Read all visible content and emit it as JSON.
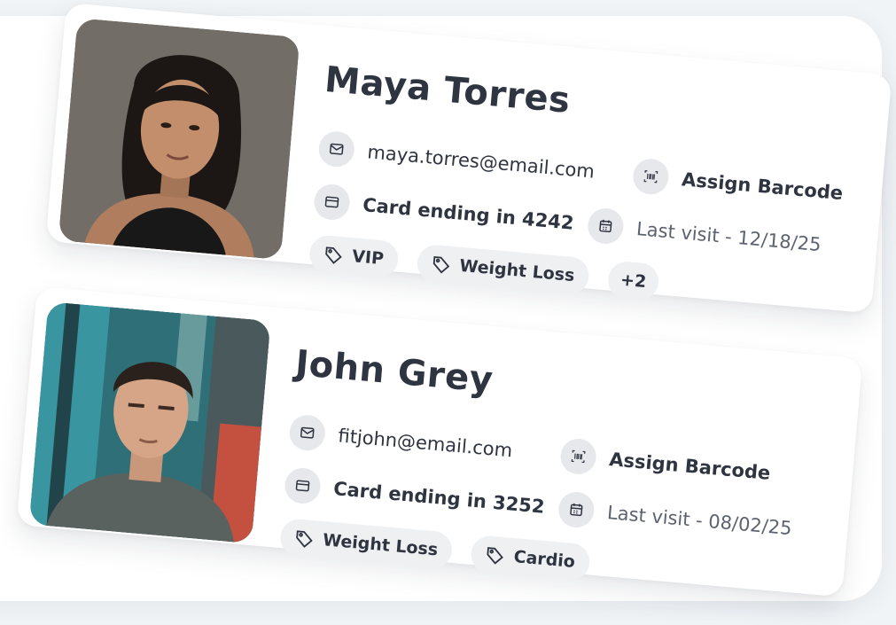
{
  "members": [
    {
      "name": "Maya Torres",
      "email": "maya.torres@email.com",
      "barcode_action": "Assign Barcode",
      "card": "Card ending in 4242",
      "last_visit": "Last visit - 12/18/25",
      "tags": [
        "VIP",
        "Weight Loss"
      ],
      "more_tags": "+2"
    },
    {
      "name": "John Grey",
      "email": "fitjohn@email.com",
      "barcode_action": "Assign Barcode",
      "card": "Card ending in 3252",
      "last_visit": "Last visit - 08/02/25",
      "tags": [
        "Weight Loss",
        "Cardio"
      ]
    }
  ],
  "colors": {
    "text": "#2f3441",
    "muted": "#5d6270",
    "icon_badge": "#e7e8ec",
    "tag_bg": "#eff0f2",
    "card_bg": "#ffffff",
    "page_bg": "#f1f4f6"
  },
  "icons": [
    "mail-icon",
    "barcode-icon",
    "credit-card-icon",
    "calendar-icon",
    "tag-icon"
  ]
}
